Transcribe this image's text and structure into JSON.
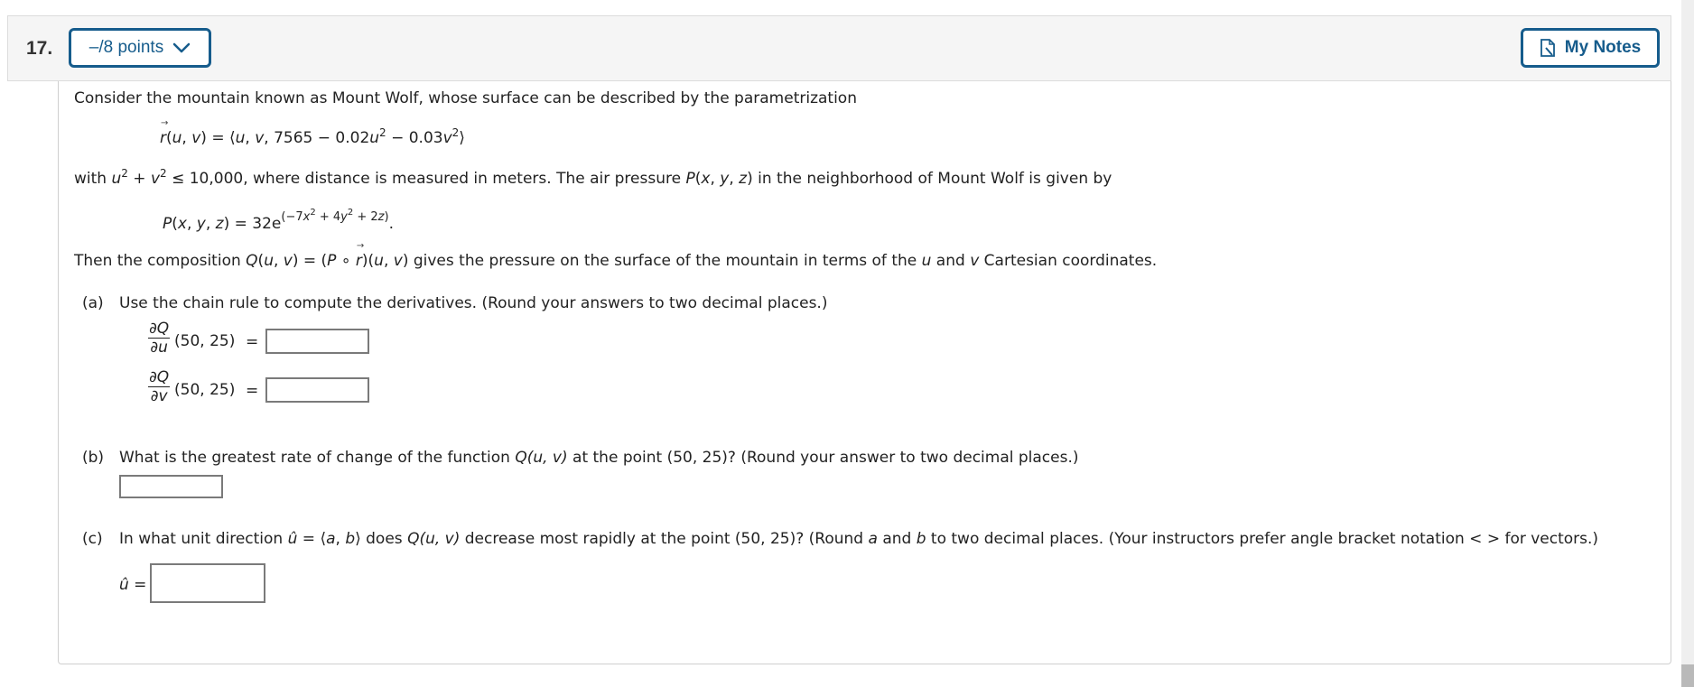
{
  "header": {
    "question_number": "17.",
    "points_label": "–/8 points",
    "points_icon": "chevron-down-icon",
    "notes_label": "My Notes",
    "notes_icon": "note-edit-icon"
  },
  "problem": {
    "intro": "Consider the mountain known as Mount Wolf, whose surface can be described by the parametrization",
    "param_eq": {
      "lhs_func": "r",
      "lhs_args": "(u, v) = ",
      "rhs": "⟨u, v, 7565 − 0.02u² − 0.03v²⟩",
      "parts": [
        "⟨",
        "u",
        ", ",
        "v",
        ", 7565 − 0.02",
        "u",
        "2",
        " − 0.03",
        "v",
        "2",
        "⟩"
      ]
    },
    "domain_text_prefix": "with ",
    "domain_text_suffix": " ≤ 10,000, where distance is measured in meters. The air pressure ",
    "domain_text_end": " in the neighborhood of Mount Wolf is given by",
    "pressure_eq": {
      "lhs": "P(x, y, z) = 32e",
      "exponent": "(−7x² + 4y² + 2z)",
      "end": "."
    },
    "composition_prefix": "Then the composition ",
    "composition_mid": " gives the pressure on the surface of the mountain in terms of the ",
    "composition_and": " and ",
    "composition_suffix": " Cartesian coordinates."
  },
  "parts": {
    "a": {
      "label": "(a)",
      "prompt": "Use the chain rule to compute the derivatives. (Round your answers to two decimal places.)",
      "items": [
        {
          "numerator": "∂Q",
          "denominator": "∂u",
          "point": "(50, 25)",
          "equals": "=",
          "value": ""
        },
        {
          "numerator": "∂Q",
          "denominator": "∂v",
          "point": "(50, 25)",
          "equals": "=",
          "value": ""
        }
      ]
    },
    "b": {
      "label": "(b)",
      "prompt_prefix": "What is the greatest rate of change of the function ",
      "prompt_func": "Q(u, v)",
      "prompt_suffix": " at the point (50, 25)? (Round your answer to two decimal places.)",
      "value": ""
    },
    "c": {
      "label": "(c)",
      "prompt_prefix": "In what unit direction ",
      "uhat": "û",
      "prompt_eq": " = ⟨",
      "a": "a",
      "b": "b",
      "prompt_mid1": "⟩ does ",
      "prompt_func": "Q(u, v)",
      "prompt_mid2": " decrease most rapidly at the point (50, 25)? (Round ",
      "prompt_and": " and ",
      "prompt_suffix": " to two decimal places. (Your instructors prefer angle bracket notation < > for vectors.)",
      "answer_label": "û =",
      "value": ""
    }
  }
}
